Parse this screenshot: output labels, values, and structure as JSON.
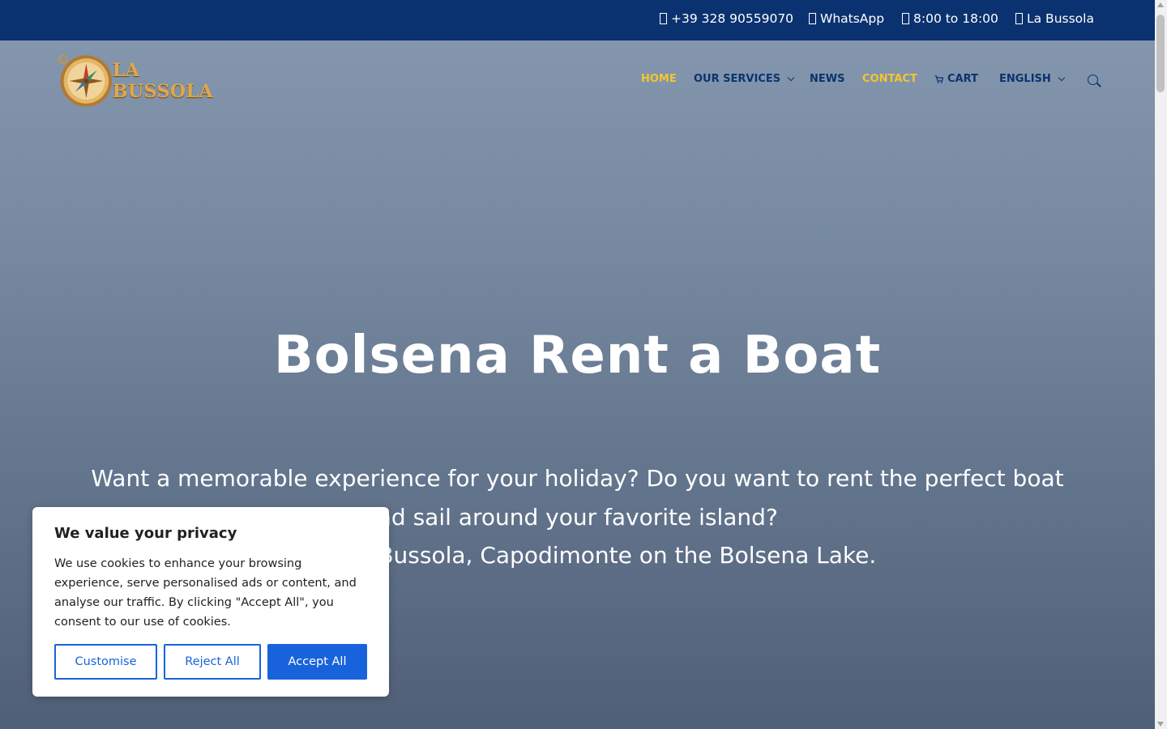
{
  "topbar": {
    "phone": "+39 328 90559070",
    "whatsapp": "WhatsApp",
    "hours": "8:00 to 18:00",
    "location": "La Bussola"
  },
  "logo": {
    "text": "LA BUSSOLA"
  },
  "nav": {
    "home": "HOME",
    "services": "OUR SERVICES",
    "news": "NEWS",
    "contact": "CONTACT",
    "cart": "CART",
    "language": "ENGLISH"
  },
  "hero": {
    "title": "Bolsena Rent a Boat",
    "line1": "Want a memorable experience for your holiday? Do you want to rent the perfect boat",
    "line2": "nd sail around your favorite island?",
    "line3": "ed at La Bussola, Capodimonte on the Bolsena Lake."
  },
  "cookie": {
    "title": "We value your privacy",
    "text": "We use cookies to enhance your browsing experience, serve personalised ads or content, and analyse our traffic. By clicking \"Accept All\", you consent to our use of cookies.",
    "customise": "Customise",
    "reject": "Reject All",
    "accept": "Accept All"
  },
  "colors": {
    "topbar": "#0b3270",
    "nav_active": "#f2c531",
    "accent_button": "#1863dc"
  },
  "icons": [
    "phone-icon",
    "whatsapp-icon",
    "clock-icon",
    "location-icon",
    "cart-icon",
    "search-icon",
    "compass-logo-icon"
  ]
}
